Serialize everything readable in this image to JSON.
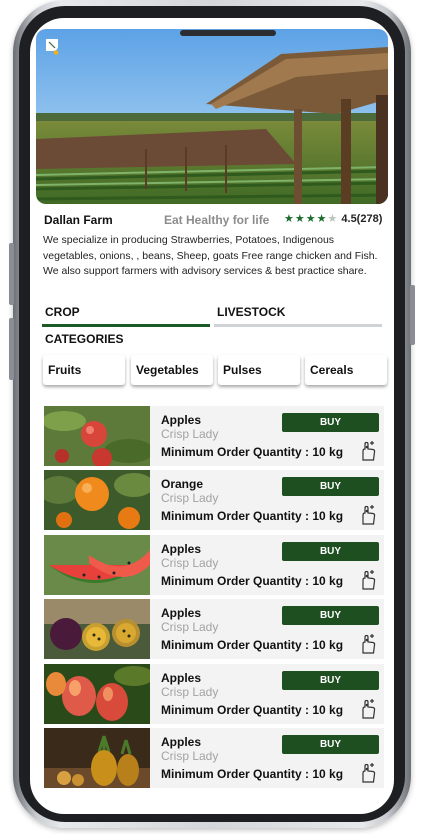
{
  "farm": {
    "name": "Dallan Farm",
    "tagline": "Eat Healthy for life",
    "rating_stars": "★★★★",
    "rating_dim_star": "★",
    "rating_value": "4.5(278)",
    "description": "We specialize in producing Strawberries, Potatoes, Indigenous vegetables, onions, , beans, Sheep, goats  Free range chicken and Fish. We also support farmers with advisory services & best practice share."
  },
  "tabs": [
    {
      "label": "CROP",
      "active": true
    },
    {
      "label": "LIVESTOCK",
      "active": false
    }
  ],
  "categories": {
    "title": "CATEGORIES",
    "items": [
      {
        "label": "Fruits"
      },
      {
        "label": "Vegetables"
      },
      {
        "label": "Pulses"
      },
      {
        "label": "Cereals"
      }
    ]
  },
  "products": [
    {
      "name": "Apples",
      "variety": "Crisp Lady",
      "moq": "Minimum Order Quantity : 10 kg",
      "buy": "BUY",
      "image": "apples"
    },
    {
      "name": "Orange",
      "variety": "Crisp Lady",
      "moq": "Minimum Order Quantity : 10 kg",
      "buy": "BUY",
      "image": "oranges"
    },
    {
      "name": "Apples",
      "variety": "Crisp Lady",
      "moq": "Minimum Order Quantity : 10 kg",
      "buy": "BUY",
      "image": "watermelon"
    },
    {
      "name": "Apples",
      "variety": "Crisp Lady",
      "moq": "Minimum Order Quantity : 10 kg",
      "buy": "BUY",
      "image": "passion-fruit"
    },
    {
      "name": "Apples",
      "variety": "Crisp Lady",
      "moq": "Minimum Order Quantity : 10 kg",
      "buy": "BUY",
      "image": "mangoes"
    },
    {
      "name": "Apples",
      "variety": "Crisp Lady",
      "moq": "Minimum Order Quantity : 10 kg",
      "buy": "BUY",
      "image": "pineapples"
    }
  ],
  "colors": {
    "accent_green": "#1d4f20",
    "star_green": "#1b6b2a",
    "card_bg": "#f3f3f3"
  },
  "icons": {
    "logo": "leaf-logo-icon",
    "cart": "add-to-cart-hand-icon"
  }
}
